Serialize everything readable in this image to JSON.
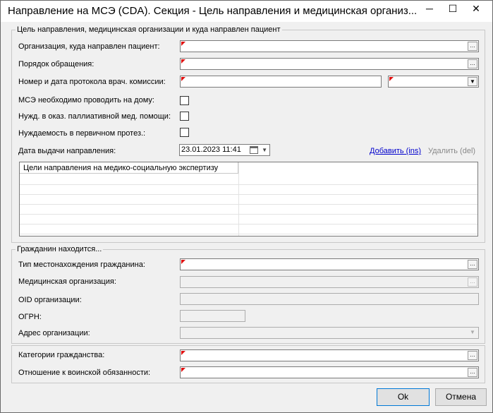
{
  "window": {
    "title": "Направление на МСЭ (CDA). Секция - Цель направления и медицинская организ...",
    "minimize": "─",
    "maximize": "☐",
    "close": "✕"
  },
  "group1": {
    "legend": "Цель направления, медицинская организации и куда направлен пациент",
    "org_label": "Организация, куда направлен пациент:",
    "order_label": "Порядок обращения:",
    "protocol_label": "Номер и дата протокола врач. комиссии:",
    "home_label": "МСЭ необходимо проводить на дому:",
    "palliative_label": "Нужд. в оказ. паллиативной мед. помощи:",
    "prosthesis_label": "Нуждаемость в первичном протез.:",
    "date_label": "Дата выдачи направления:",
    "date_value": "23.01.2023 11:41",
    "add_link": "Добавить (ins)",
    "delete_link": "Удалить (del)",
    "grid_header": "Цели направления на медико-социальную экспертизу"
  },
  "group2": {
    "legend": "Гражданин находится...",
    "location_type_label": "Тип местонахождения гражданина:",
    "med_org_label": "Медицинская организация:",
    "oid_label": "OID организации:",
    "ogrn_label": "ОГРН:",
    "address_label": "Адрес организации:"
  },
  "group3": {
    "citizenship_label": "Категории гражданства:",
    "military_label": "Отношение к воинской обязанности:"
  },
  "buttons": {
    "ok": "Ok",
    "cancel": "Отмена"
  },
  "icons": {
    "ellipsis": "...",
    "dropdown": "▼"
  },
  "colors": {
    "required_marker": "#e01010",
    "link": "#0000cc"
  }
}
